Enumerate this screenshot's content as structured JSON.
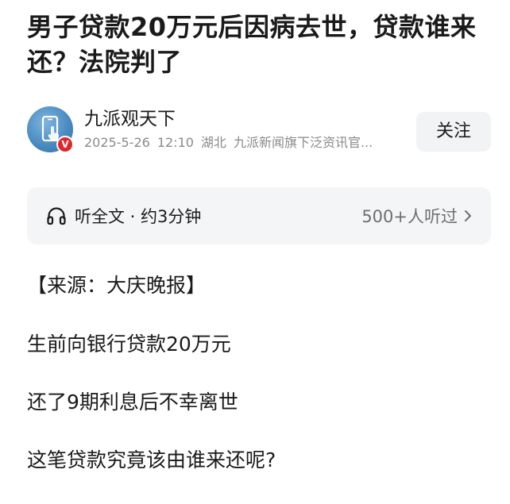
{
  "article": {
    "title": "男子贷款20万元后因病去世，贷款谁来还？法院判了"
  },
  "author": {
    "name": "九派观天下",
    "avatar_icon": "phone-touch-avatar-icon",
    "verified_badge": "V",
    "date": "2025-5-26",
    "time": "12:10",
    "location": "湖北",
    "description": "九派新闻旗下泛资讯官...",
    "follow_label": "关注"
  },
  "listen": {
    "icon": "headphone-icon",
    "label": "听全文 · 约3分钟",
    "count": "500+人听过",
    "chevron_icon": "chevron-right-icon"
  },
  "body": {
    "paragraphs": [
      "【来源：大庆晚报】",
      "生前向银行贷款20万元",
      "还了9期利息后不幸离世",
      "这笔贷款究竟该由谁来还呢?"
    ]
  },
  "colors": {
    "text": "#1a1a1a",
    "meta": "#8a8a8a",
    "button_bg": "#f2f3f5",
    "listen_bg": "#f4f5f7",
    "verified": "#e0262b",
    "avatar": "#4a8cc2"
  }
}
